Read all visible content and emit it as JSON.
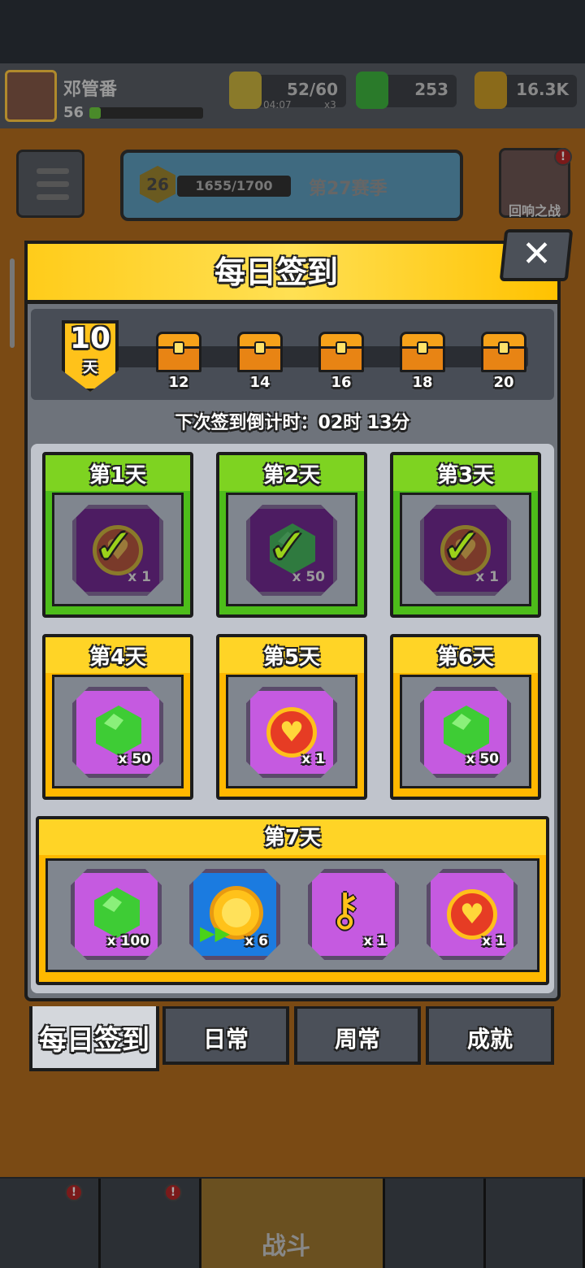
{
  "player": {
    "name": "邓管番",
    "level": "56"
  },
  "resources": {
    "energy": "52/60",
    "energy_timer": "04:07",
    "energy_multiplier": "x3",
    "gems": "253",
    "coins": "16.3K"
  },
  "season": {
    "level": "26",
    "progress": "1655/1700",
    "label": "第27赛季"
  },
  "echo_battle": {
    "label": "回响之战",
    "badge": "!"
  },
  "dialog": {
    "title": "每日签到",
    "close": "✕",
    "streak": {
      "days": "10",
      "unit": "天"
    },
    "milestones": [
      "12",
      "14",
      "16",
      "18",
      "20"
    ],
    "countdown": "下次签到倒计时：02时 13分",
    "days": [
      {
        "label": "第1天",
        "item": "heart-coin",
        "qty": "x 1",
        "claimed": true
      },
      {
        "label": "第2天",
        "item": "gem",
        "qty": "x 50",
        "claimed": true
      },
      {
        "label": "第3天",
        "item": "heart-coin",
        "qty": "x 1",
        "claimed": true
      },
      {
        "label": "第4天",
        "item": "gem",
        "qty": "x 50",
        "claimed": false
      },
      {
        "label": "第5天",
        "item": "heart-coin",
        "qty": "x 1",
        "claimed": false
      },
      {
        "label": "第6天",
        "item": "gem",
        "qty": "x 50",
        "claimed": false
      }
    ],
    "day7": {
      "label": "第7天",
      "items": [
        {
          "item": "gem",
          "qty": "x 100"
        },
        {
          "item": "gold-coin-boost",
          "qty": "x 6"
        },
        {
          "item": "key",
          "qty": "x 1"
        },
        {
          "item": "heart-coin",
          "qty": "x 1"
        }
      ]
    },
    "tabs": [
      "每日签到",
      "日常",
      "周常",
      "成就"
    ]
  },
  "nav": {
    "battle": "战斗",
    "badge": "!"
  },
  "colors": {
    "header_yellow": "#ffd426",
    "claimed_green": "#7ed321",
    "item_purple": "#c55ae0",
    "panel_gray": "#6e737b"
  }
}
